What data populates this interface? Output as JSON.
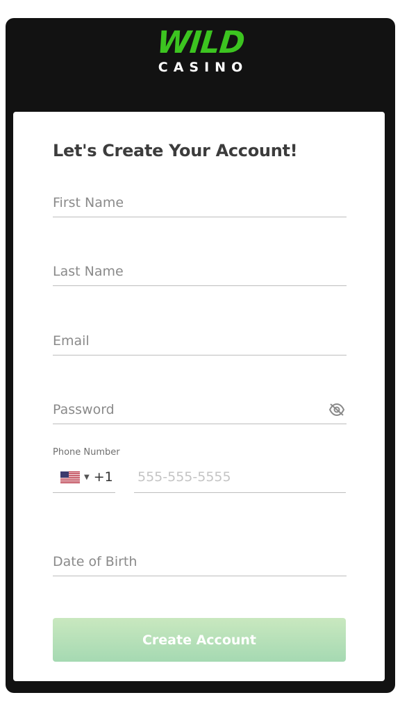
{
  "logo": {
    "wordmark": "WILD",
    "subtitle": "CASINO"
  },
  "form": {
    "title": "Let's Create Your Account!",
    "first_name_placeholder": "First Name",
    "last_name_placeholder": "Last Name",
    "email_placeholder": "Email",
    "password_placeholder": "Password",
    "password_toggle_icon": "eye-off-icon",
    "phone": {
      "label": "Phone Number",
      "country_flag": "us-flag-icon",
      "dial_code": "+1",
      "placeholder": "555-555-5555"
    },
    "dob_placeholder": "Date of Birth",
    "submit_label": "Create Account"
  },
  "colors": {
    "brand_green": "#3cc420",
    "frame_background": "#121212",
    "button_disabled": "#b5e0b8"
  }
}
